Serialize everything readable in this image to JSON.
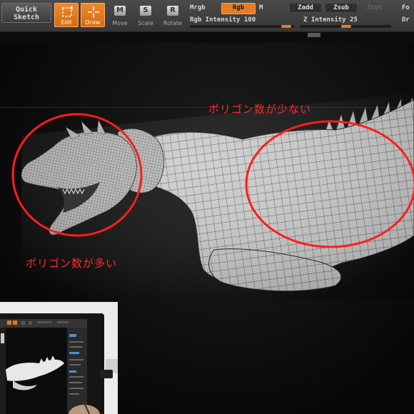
{
  "toolbar": {
    "quick_sketch": {
      "line1": "Quick",
      "line2": "Sketch"
    },
    "edit_label": "Edit",
    "draw_label": "Draw",
    "move": {
      "key": "M",
      "label": "Move"
    },
    "scale": {
      "key": "S",
      "label": "Scale"
    },
    "rotate": {
      "key": "R",
      "label": "Rotate"
    },
    "mrgb": "Mrgb",
    "rgb": "Rgb",
    "m": "M",
    "rgb_intensity_label": "Rgb Intensity 100",
    "rgb_intensity": 100,
    "zadd": "Zadd",
    "zsub": "Zsub",
    "zcut": "Zcut",
    "z_intensity_label": "Z Intensity 25",
    "z_intensity": 25,
    "focal_partial": "Fo",
    "draw_partial": "Dr",
    "accent_color": "#e87d20"
  },
  "annotations": {
    "low_poly": "ポリゴン数が少ない",
    "high_poly": "ポリゴン数が多い",
    "circle_color": "#ff1e1e"
  }
}
